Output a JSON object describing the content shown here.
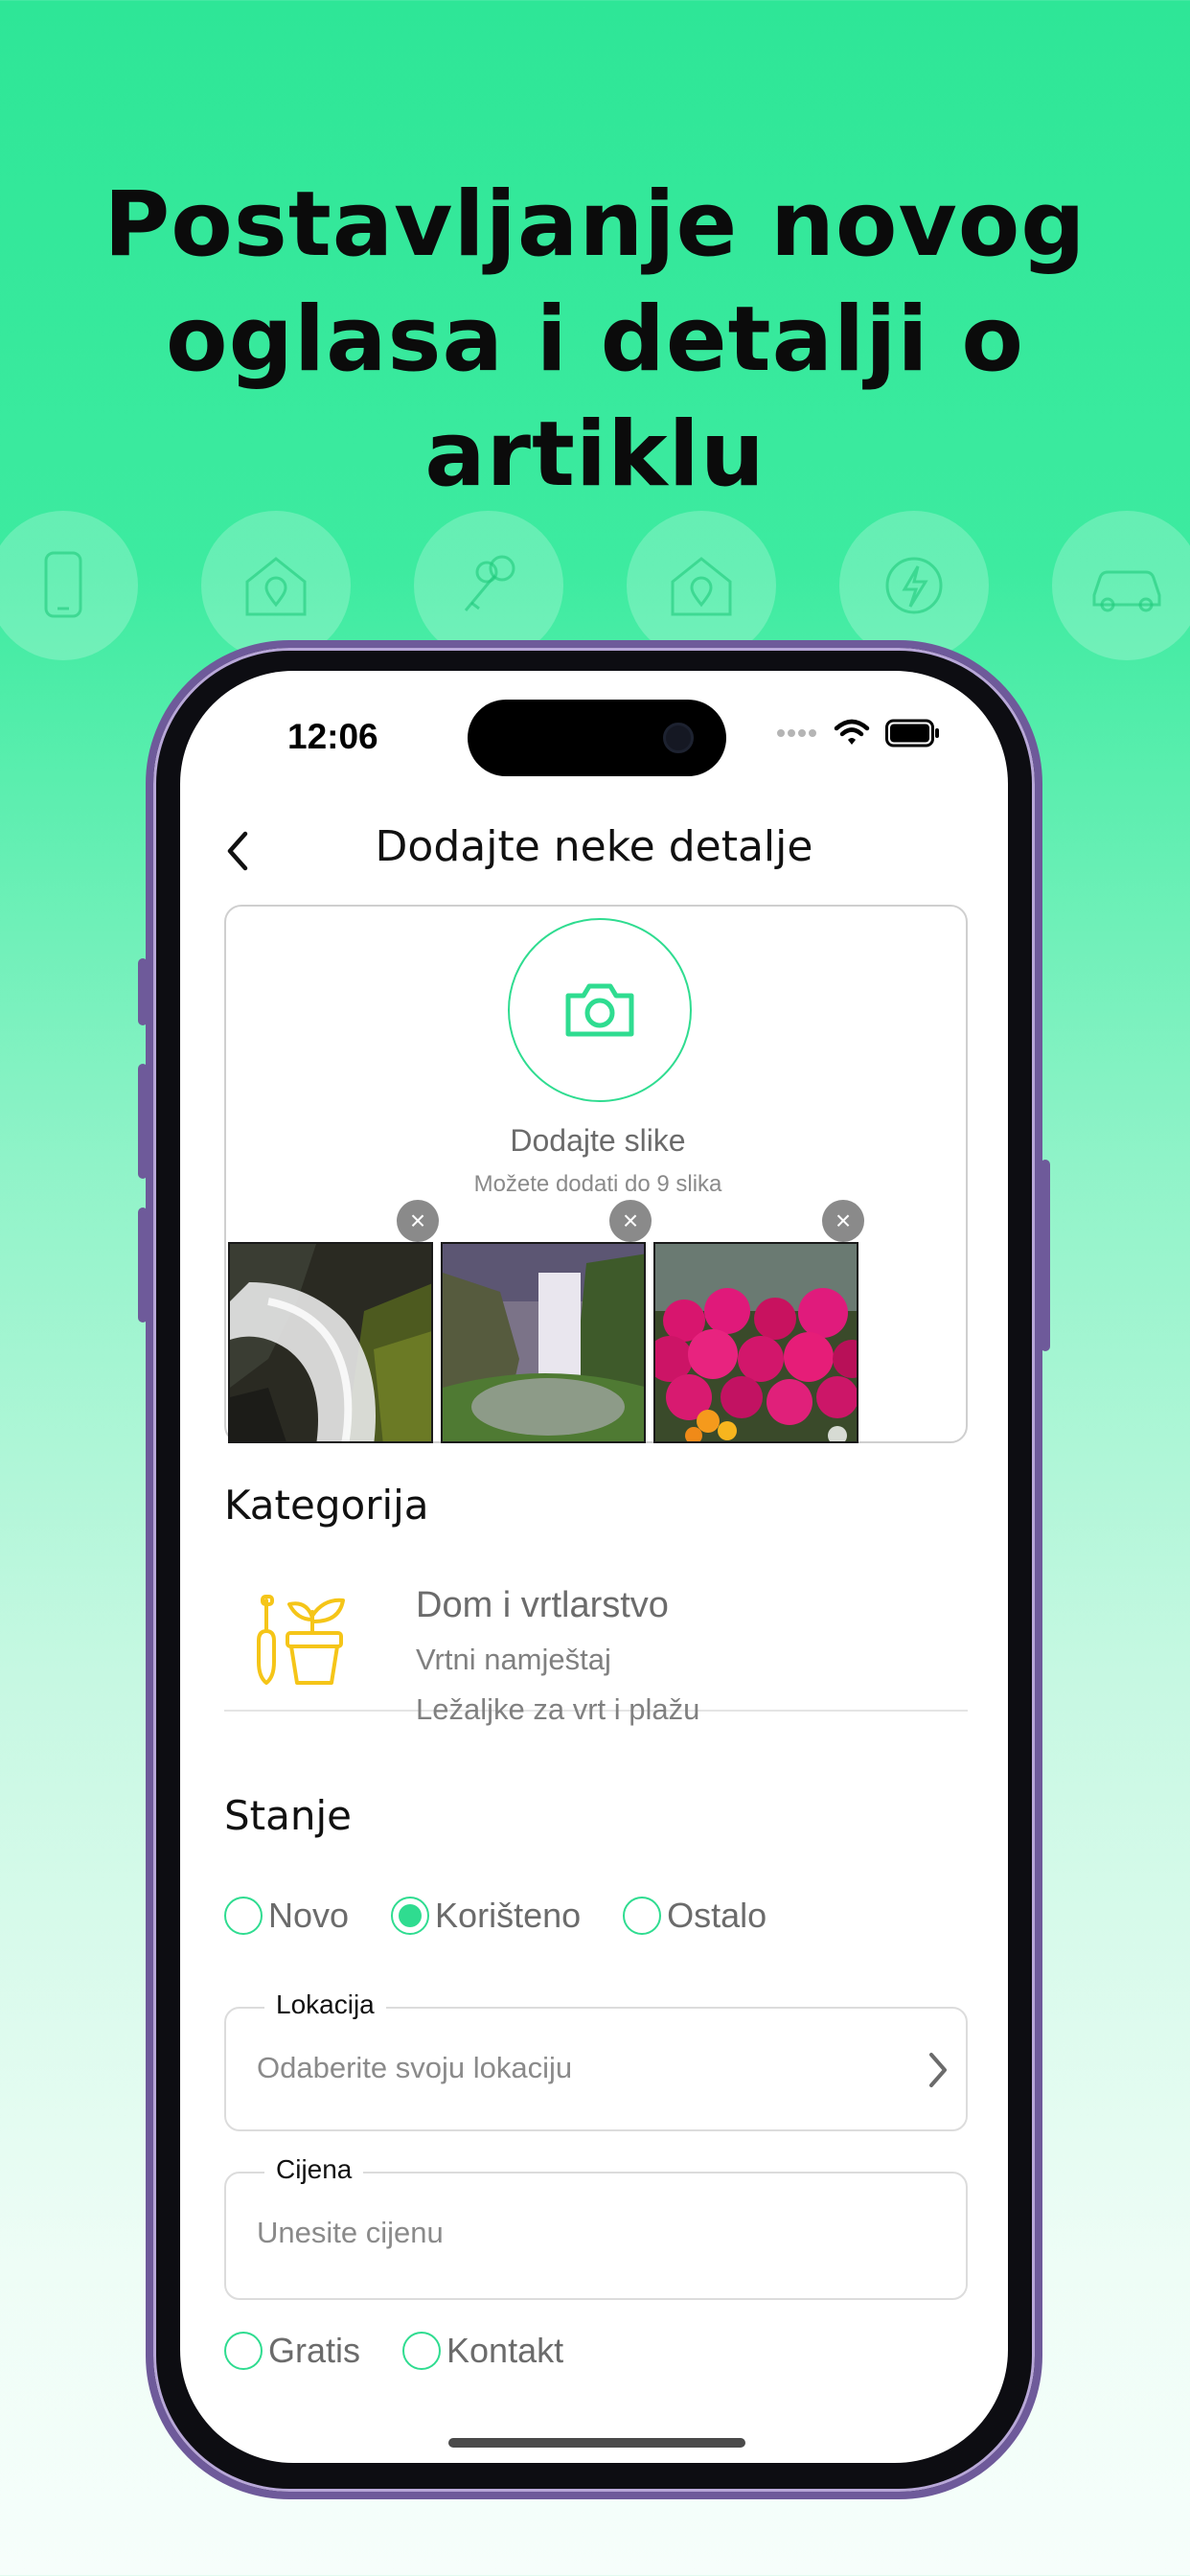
{
  "hero": {
    "title_line1": "Postavljanje novog",
    "title_line2": "oglasa i detalji o artiklu"
  },
  "category_icons": [
    "phone-icon",
    "house-location-icon",
    "keys-icon",
    "house-location-icon",
    "energy-icon",
    "car-icon"
  ],
  "status_bar": {
    "time": "12:06"
  },
  "nav": {
    "title": "Dodajte neke detalje"
  },
  "upload": {
    "title": "Dodajte slike",
    "subtitle": "Možete dodati do 9 slika",
    "remove_symbol": "×"
  },
  "category_section": {
    "title": "Kategorija",
    "main": "Dom i vrtlarstvo",
    "sub1": "Vrtni namještaj",
    "sub2": "Ležaljke za vrt i plažu"
  },
  "condition_section": {
    "title": "Stanje",
    "options": [
      "Novo",
      "Korišteno",
      "Ostalo"
    ],
    "selected": "Korišteno"
  },
  "location_field": {
    "label": "Lokacija",
    "placeholder": "Odaberite svoju lokaciju"
  },
  "price_field": {
    "label": "Cijena",
    "placeholder": "Unesite cijenu"
  },
  "price_options": [
    "Gratis",
    "Kontakt"
  ],
  "colors": {
    "accent": "#2fdc90",
    "icon_yellow": "#f5c518",
    "phone_frame": "#6e5a9a"
  }
}
